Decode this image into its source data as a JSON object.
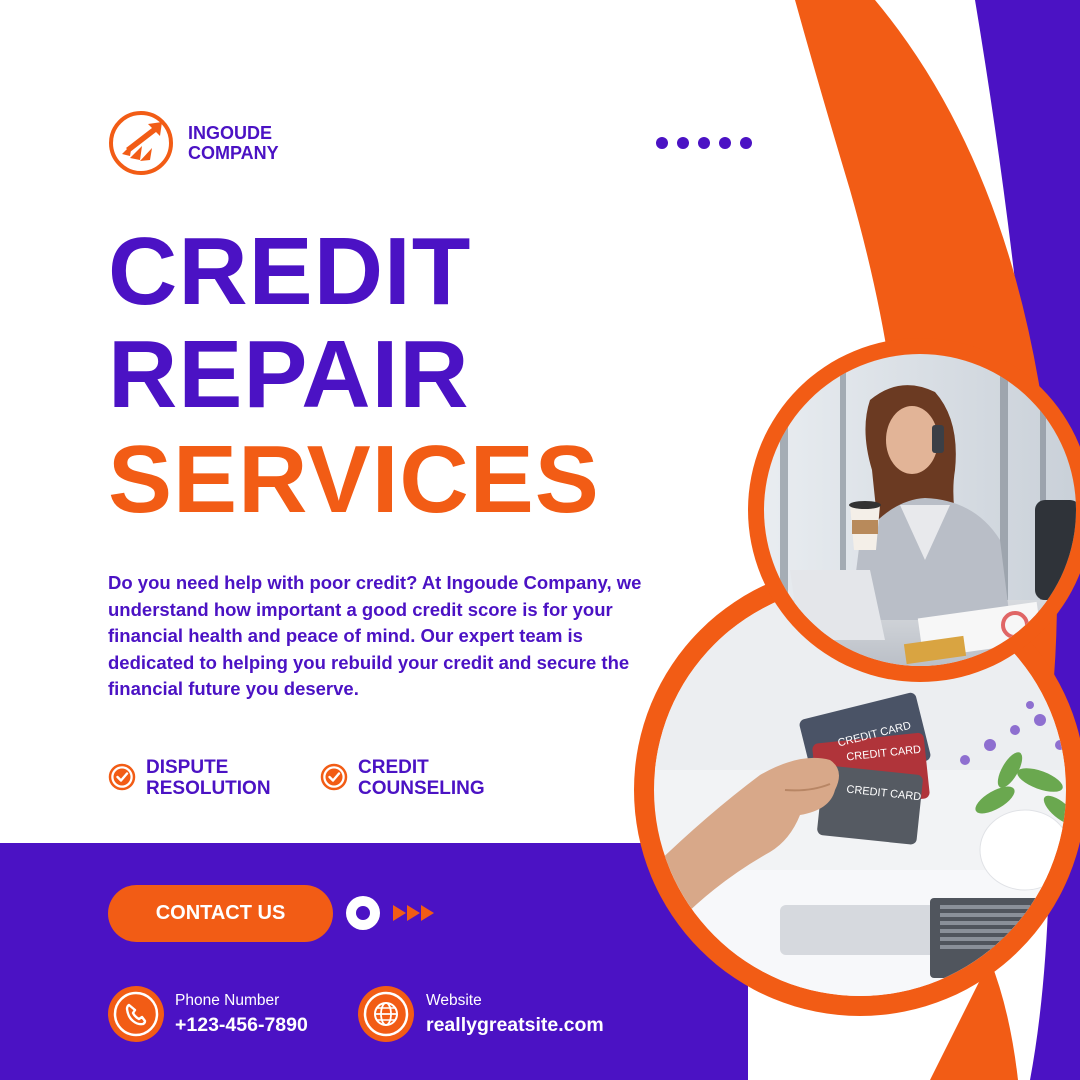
{
  "brand": {
    "name_line1": "INGOUDE",
    "name_line2": "COMPANY",
    "logo_icon": "rising-arrow-icon"
  },
  "headline": {
    "line1": "CREDIT",
    "line2": "REPAIR",
    "line3": "SERVICES"
  },
  "description": "Do you need help with poor credit? At Ingoude Company, we understand how important a good credit score is for your financial health and peace of mind. Our expert team is dedicated to helping you rebuild your credit and secure the financial future you deserve.",
  "features": [
    {
      "line1": "DISPUTE",
      "line2": "RESOLUTION",
      "icon": "check-circle-icon"
    },
    {
      "line1": "CREDIT",
      "line2": "COUNSELING",
      "icon": "check-circle-icon"
    }
  ],
  "cta": {
    "label": "CONTACT US"
  },
  "contact": {
    "phone": {
      "label": "Phone Number",
      "value": "+123-456-7890",
      "icon": "phone-icon"
    },
    "website": {
      "label": "Website",
      "value": "reallygreatsite.com",
      "icon": "globe-icon"
    }
  },
  "photos": {
    "top": {
      "card_text": ""
    },
    "bottom": {
      "card_labels": [
        "CREDIT CARD",
        "CREDIT CARD",
        "CREDIT CARD"
      ]
    }
  },
  "colors": {
    "purple": "#4b12c4",
    "orange": "#f25c15",
    "white": "#ffffff"
  }
}
